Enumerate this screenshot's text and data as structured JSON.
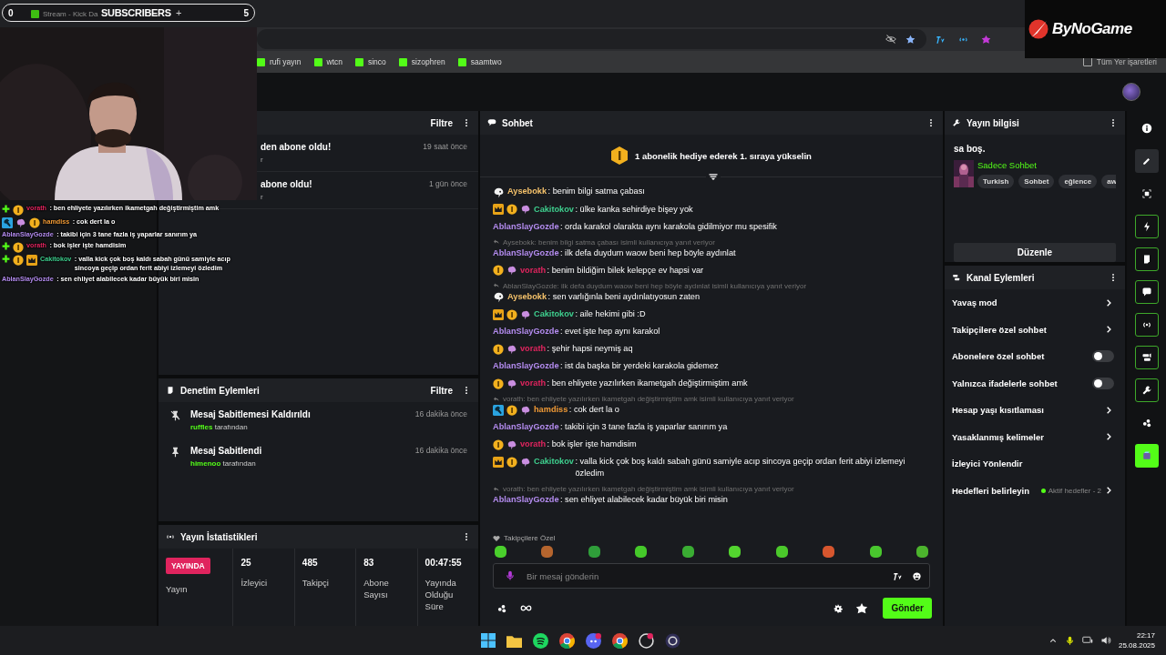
{
  "overlay": {
    "subscribers": {
      "left_count": "0",
      "label": "SUBSCRIBERS",
      "plus": "+",
      "right_count": "5"
    },
    "logo": "ByNoGame",
    "chat": [
      {
        "badges": [
          {
            "kind": "follow"
          },
          {
            "kind": "sub"
          }
        ],
        "user": "vorath",
        "color": "#e0245e",
        "text": ": ben ehliyete yazılırken ikametgah değiştirmiştim amk"
      },
      {
        "badges": [
          {
            "kind": "mod"
          },
          {
            "kind": "gift"
          },
          {
            "kind": "sub"
          }
        ],
        "user": "hamdiss",
        "color": "#f09a36",
        "text": ": cok dert la o"
      },
      {
        "user": "AblanSlayGozde",
        "color": "#b48cf0",
        "text": ": takibi için 3 tane fazla iş yaparlar sanırım ya"
      },
      {
        "badges": [
          {
            "kind": "follow"
          },
          {
            "kind": "sub"
          }
        ],
        "user": "vorath",
        "color": "#e0245e",
        "text": ": bok işler işte hamdisim"
      },
      {
        "badges": [
          {
            "kind": "follow"
          },
          {
            "kind": "sub"
          },
          {
            "kind": "crown"
          }
        ],
        "user": "Cakitokov",
        "color": "#3ecf8e",
        "text": ": valla kick çok boş kaldı sabah günü samiyle acıp sincoya geçip ordan ferit abiyi izlemeyi özledim"
      },
      {
        "user": "AblanSlayGozde",
        "color": "#b48cf0",
        "text": ": sen ehliyet alabilecek kadar büyük biri misin"
      }
    ]
  },
  "browser": {
    "tab": "Stream - Kick Da",
    "bookmarks": [
      "rufi yayın",
      "wtcn",
      "sinco",
      "sizophren",
      "saamtwo"
    ],
    "all_bookmarks": "Tüm Yer işaretleri"
  },
  "activity": {
    "filter": "Filtre",
    "items": [
      {
        "title": "den abone oldu!",
        "subtitle": "r",
        "time": "19 saat önce"
      },
      {
        "title": "abone oldu!",
        "subtitle": "r",
        "time": "1 gün önce"
      }
    ]
  },
  "moderation": {
    "title": "Denetim Eylemleri",
    "filter": "Filtre",
    "items": [
      {
        "kind": "unpin",
        "title": "Mesaj Sabitlemesi Kaldırıldı",
        "user": "ruffles",
        "by": "tarafından",
        "time": "16 dakika önce"
      },
      {
        "kind": "pin",
        "title": "Mesaj Sabitlendi",
        "user": "himenoo",
        "by": "tarafından",
        "time": "16 dakika önce"
      }
    ]
  },
  "stats": {
    "title": "Yayın İstatistikleri",
    "live_badge": "YAYINDA",
    "live_label": "Yayın",
    "items": [
      {
        "value": "25",
        "label": "İzleyici"
      },
      {
        "value": "485",
        "label": "Takipçi"
      },
      {
        "value": "83",
        "label": "Abone Sayısı"
      },
      {
        "value": "00:47:55",
        "label": "Yayında Olduğu Süre"
      }
    ]
  },
  "chat": {
    "title": "Sohbet",
    "goal": "1 abonelik hediye ederek 1. sıraya yükselin",
    "messages": [
      {
        "badges": [
          {
            "kind": "ghost"
          }
        ],
        "user": "Aysebokk",
        "color": "#f5c26b",
        "text": ": benim bilgi satma çabası"
      },
      {
        "badges": [
          {
            "kind": "crown"
          },
          {
            "kind": "sub"
          },
          {
            "kind": "gift"
          }
        ],
        "user": "Cakitokov",
        "color": "#3ecf8e",
        "text": ": ülke kanka sehirdiye bişey yok"
      },
      {
        "user": "AblanSlayGozde",
        "color": "#b48cf0",
        "text": ": orda karakol olarakta aynı karakola gidilmiyor mu spesifik"
      },
      {
        "reply": "Aysebokk: benim bilgi satma çabası isimli kullanıcıya yanıt veriyor",
        "user": "AblanSlayGozde",
        "color": "#b48cf0",
        "text": ": ilk defa duydum waow beni hep böyle aydınlat"
      },
      {
        "badges": [
          {
            "kind": "sub"
          },
          {
            "kind": "gift"
          }
        ],
        "user": "vorath",
        "color": "#e0245e",
        "text": ": benim bildiğim bilek kelepçe ev hapsi var"
      },
      {
        "reply": "AblanSlayGozde: ilk defa duydum waow beni hep böyle aydınlat isimli kullanıcıya yanıt veriyor",
        "badges": [
          {
            "kind": "ghost"
          }
        ],
        "user": "Aysebokk",
        "color": "#f5c26b",
        "text": ": sen varlığınla beni aydınlatıyosun zaten"
      },
      {
        "badges": [
          {
            "kind": "crown"
          },
          {
            "kind": "sub"
          },
          {
            "kind": "gift"
          }
        ],
        "user": "Cakitokov",
        "color": "#3ecf8e",
        "text": ": aile hekimi gibi :D"
      },
      {
        "user": "AblanSlayGozde",
        "color": "#b48cf0",
        "text": ": evet işte hep aynı karakol"
      },
      {
        "badges": [
          {
            "kind": "sub"
          },
          {
            "kind": "gift"
          }
        ],
        "user": "vorath",
        "color": "#e0245e",
        "text": ": şehir hapsi neymiş aq"
      },
      {
        "user": "AblanSlayGozde",
        "color": "#b48cf0",
        "text": ": ist da başka bir yerdeki karakola gidemez"
      },
      {
        "badges": [
          {
            "kind": "sub"
          },
          {
            "kind": "gift"
          }
        ],
        "user": "vorath",
        "color": "#e0245e",
        "text": ": ben ehliyete yazılırken ikametgah değiştirmiştim amk"
      },
      {
        "reply": "vorath: ben ehliyete yazılırken ikametgah değiştirmiştim amk isimli kullanıcıya yanıt veriyor",
        "badges": [
          {
            "kind": "mod"
          },
          {
            "kind": "sub"
          },
          {
            "kind": "gift"
          }
        ],
        "user": "hamdiss",
        "color": "#f09a36",
        "text": ": cok dert la o"
      },
      {
        "user": "AblanSlayGozde",
        "color": "#b48cf0",
        "text": ": takibi için 3 tane fazla iş yaparlar sanırım ya"
      },
      {
        "badges": [
          {
            "kind": "sub"
          },
          {
            "kind": "gift"
          }
        ],
        "user": "vorath",
        "color": "#e0245e",
        "text": ": bok işler işte hamdisim"
      },
      {
        "badges": [
          {
            "kind": "crown"
          },
          {
            "kind": "sub"
          },
          {
            "kind": "gift"
          }
        ],
        "user": "Cakitokov",
        "color": "#3ecf8e",
        "text": ": valla kick çok boş kaldı sabah günü samiyle acıp sincoya geçip ordan ferit abiyi izlemeyi özledim"
      },
      {
        "reply": "vorath: ben ehliyete yazılırken ikametgah değiştirmiştim amk isimli kullanıcıya yanıt veriyor",
        "user": "AblanSlayGozde",
        "color": "#b48cf0",
        "text": ": sen ehliyet alabilecek kadar büyük biri misin"
      }
    ],
    "emote_section": "Takipçilere Özel",
    "input": {
      "placeholder": "Bir mesaj gönderin"
    },
    "send": "Gönder"
  },
  "stream_info": {
    "title": "Yayın bilgisi",
    "stream_title": "sa boş.",
    "category": "Sadece Sohbet",
    "tags": [
      "Turkish",
      "Sohbet",
      "eğlence",
      "aw"
    ],
    "edit": "Düzenle"
  },
  "channel_actions": {
    "title": "Kanal Eylemleri",
    "items": [
      {
        "kind": "link",
        "label": "Yavaş mod"
      },
      {
        "kind": "link",
        "label": "Takipçilere özel sohbet"
      },
      {
        "kind": "toggle",
        "label": "Abonelere özel sohbet",
        "on": false
      },
      {
        "kind": "toggle",
        "label": "Yalnızca ifadelerle sohbet",
        "on": false
      },
      {
        "kind": "link",
        "label": "Hesap yaşı kısıtlaması"
      },
      {
        "kind": "link",
        "label": "Yasaklanmış kelimeler"
      },
      {
        "kind": "plain",
        "label": "İzleyici Yönlendir"
      },
      {
        "kind": "goal",
        "label": "Hedefleri belirleyin",
        "status": "Aktif hedefler - 2"
      }
    ]
  },
  "rail": [
    {
      "selected": false,
      "active": false
    },
    {
      "selected": true,
      "active": false
    },
    {
      "selected": false,
      "active": false
    },
    {
      "selected": false,
      "active": true
    },
    {
      "selected": false,
      "active": true
    },
    {
      "selected": false,
      "active": true
    },
    {
      "selected": false,
      "active": true
    },
    {
      "selected": false,
      "active": true
    },
    {
      "selected": false,
      "active": true
    },
    {
      "selected": false,
      "active": false
    },
    {
      "selected": true,
      "active": false
    }
  ],
  "taskbar": {
    "time": "22:17",
    "date": "25.08.2025"
  }
}
